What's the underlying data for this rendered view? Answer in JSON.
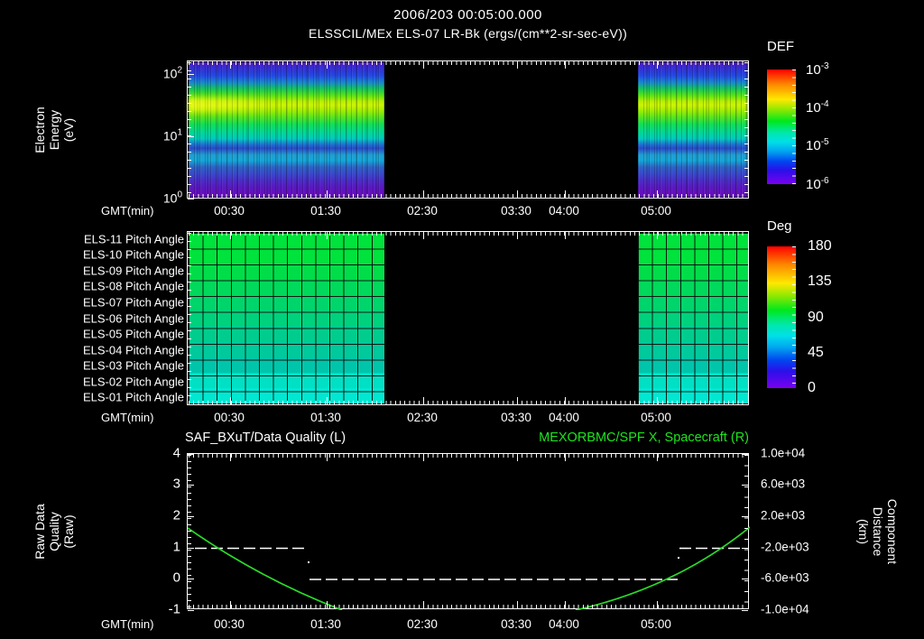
{
  "header": {
    "datetime": "2006/203 00:05:00.000",
    "subtitle": "ELSSCIL/MEx ELS-07 LR-Bk  (ergs/(cm**2-sr-sec-eV))"
  },
  "axis": {
    "xlabel": "GMT(min)",
    "xticks": [
      "00:30",
      "01:30",
      "02:30",
      "03:30",
      "04:00",
      "05:00"
    ]
  },
  "spectrogram": {
    "ylabel": "Electron Energy\n(eV)",
    "yticks": [
      {
        "base": "10",
        "exp": "2"
      },
      {
        "base": "10",
        "exp": "1"
      },
      {
        "base": "10",
        "exp": "0"
      }
    ],
    "colorbar": {
      "title": "DEF",
      "ticks": [
        {
          "base": "10",
          "exp": "-3"
        },
        {
          "base": "10",
          "exp": "-4"
        },
        {
          "base": "10",
          "exp": "-5"
        },
        {
          "base": "10",
          "exp": "-6"
        }
      ]
    }
  },
  "pitch": {
    "rows": [
      {
        "label": "ELS-11 Pitch Angle",
        "color": "#00e23c"
      },
      {
        "label": "ELS-10 Pitch Angle",
        "color": "#00e23c"
      },
      {
        "label": "ELS-09 Pitch Angle",
        "color": "#00dd49"
      },
      {
        "label": "ELS-08 Pitch Angle",
        "color": "#00d95b"
      },
      {
        "label": "ELS-07 Pitch Angle",
        "color": "#00d56c"
      },
      {
        "label": "ELS-06 Pitch Angle",
        "color": "#00d17d"
      },
      {
        "label": "ELS-05 Pitch Angle",
        "color": "#00cd8d"
      },
      {
        "label": "ELS-04 Pitch Angle",
        "color": "#00c99c"
      },
      {
        "label": "ELS-03 Pitch Angle",
        "color": "#00c5ab"
      },
      {
        "label": "ELS-02 Pitch Angle",
        "color": "#00e0c4"
      },
      {
        "label": "ELS-01 Pitch Angle",
        "color": "#00e8d2"
      }
    ],
    "colorbar": {
      "title": "Deg",
      "ticks": [
        "180",
        "135",
        "90",
        "45",
        "0"
      ]
    }
  },
  "quality": {
    "title_left": "SAF_BXuT/Data Quality (L)",
    "title_right": "MEXORBMC/SPF X, Spacecraft (R)",
    "ylabel": "Raw Data Quality\n(Raw)",
    "yticks": [
      "4",
      "3",
      "2",
      "1",
      "0",
      "-1"
    ],
    "right_ylabel": "Component Distance\n(km)",
    "right_yticks": [
      "1.0e+04",
      "6.0e+03",
      "2.0e+03",
      "-2.0e+03",
      "-6.0e+03",
      "-1.0e+04"
    ]
  },
  "colors": {
    "accent_green": "#1ee41e",
    "curve_green": "#2ada2a",
    "axis_white": "#ffffff",
    "background": "#000000"
  },
  "chart_data": [
    {
      "panel": "electron_energy_spectrogram",
      "type": "heatmap",
      "title": "ELSSCIL/MEx ELS-07 LR-Bk",
      "units": "ergs/(cm**2-sr-sec-eV)",
      "xlabel": "GMT(min)",
      "ylabel": "Electron Energy (eV)",
      "yscale": "log",
      "ylim": [
        1,
        160
      ],
      "x_ticks": [
        "00:30",
        "01:30",
        "02:30",
        "03:30",
        "04:00",
        "05:00"
      ],
      "colorbar": {
        "label": "DEF",
        "scale": "log",
        "range_min": 1e-06,
        "range_max": 0.001
      },
      "data_coverage_gmt": [
        [
          "00:05",
          "02:07"
        ],
        [
          "04:45",
          "05:54"
        ]
      ],
      "description": "Differential energy flux vs time; bright yellow-green flux peak near 20-40 eV (~1e-4), cyan/blue bands below 10 eV, violet near 1 eV; black data gap between coverage intervals."
    },
    {
      "panel": "pitch_angle",
      "type": "heatmap",
      "rows": [
        "ELS-11 Pitch Angle",
        "ELS-10 Pitch Angle",
        "ELS-09 Pitch Angle",
        "ELS-08 Pitch Angle",
        "ELS-07 Pitch Angle",
        "ELS-06 Pitch Angle",
        "ELS-05 Pitch Angle",
        "ELS-04 Pitch Angle",
        "ELS-03 Pitch Angle",
        "ELS-02 Pitch Angle",
        "ELS-01 Pitch Angle"
      ],
      "colorbar": {
        "label": "Deg",
        "range": [
          0,
          180
        ]
      },
      "approx_row_values_deg": [
        105,
        105,
        101,
        97,
        93,
        89,
        85,
        81,
        77,
        68,
        63
      ],
      "data_coverage_gmt": [
        [
          "00:05",
          "02:07"
        ],
        [
          "04:45",
          "05:54"
        ]
      ]
    },
    {
      "panel": "quality_and_distance",
      "type": "line",
      "xlabel": "GMT(min)",
      "x_ticks": [
        "00:30",
        "01:30",
        "02:30",
        "03:30",
        "04:00",
        "05:00"
      ],
      "left_axis": {
        "label": "Raw Data Quality (Raw)",
        "range": [
          -1,
          4
        ]
      },
      "right_axis": {
        "label": "Component Distance (km)",
        "range": [
          -10000,
          10000
        ]
      },
      "series": [
        {
          "name": "SAF_BXuT/Data Quality (L)",
          "axis": "left",
          "style": "dashed white",
          "segments": [
            {
              "value": 1,
              "from_gmt": "00:09",
              "to_gmt": "01:20"
            },
            {
              "value": 0,
              "from_gmt": "01:21",
              "to_gmt": "05:10"
            },
            {
              "value": 1,
              "from_gmt": "05:11",
              "to_gmt": "05:50"
            }
          ]
        },
        {
          "name": "MEXORBMC/SPF X, Spacecraft (R)",
          "axis": "right",
          "style": "solid green",
          "points": [
            {
              "gmt": "00:05",
              "km": 500
            },
            {
              "gmt": "00:24",
              "km": -2300
            },
            {
              "gmt": "00:57",
              "km": -6200
            },
            {
              "gmt": "01:25",
              "km": -8500
            },
            {
              "gmt": "01:43",
              "km": -10000
            },
            {
              "gmt": "04:06",
              "km": -10000
            },
            {
              "gmt": "05:10",
              "km": -5400
            },
            {
              "gmt": "05:33",
              "km": -2200
            },
            {
              "gmt": "05:54",
              "km": 575
            }
          ]
        }
      ]
    }
  ]
}
